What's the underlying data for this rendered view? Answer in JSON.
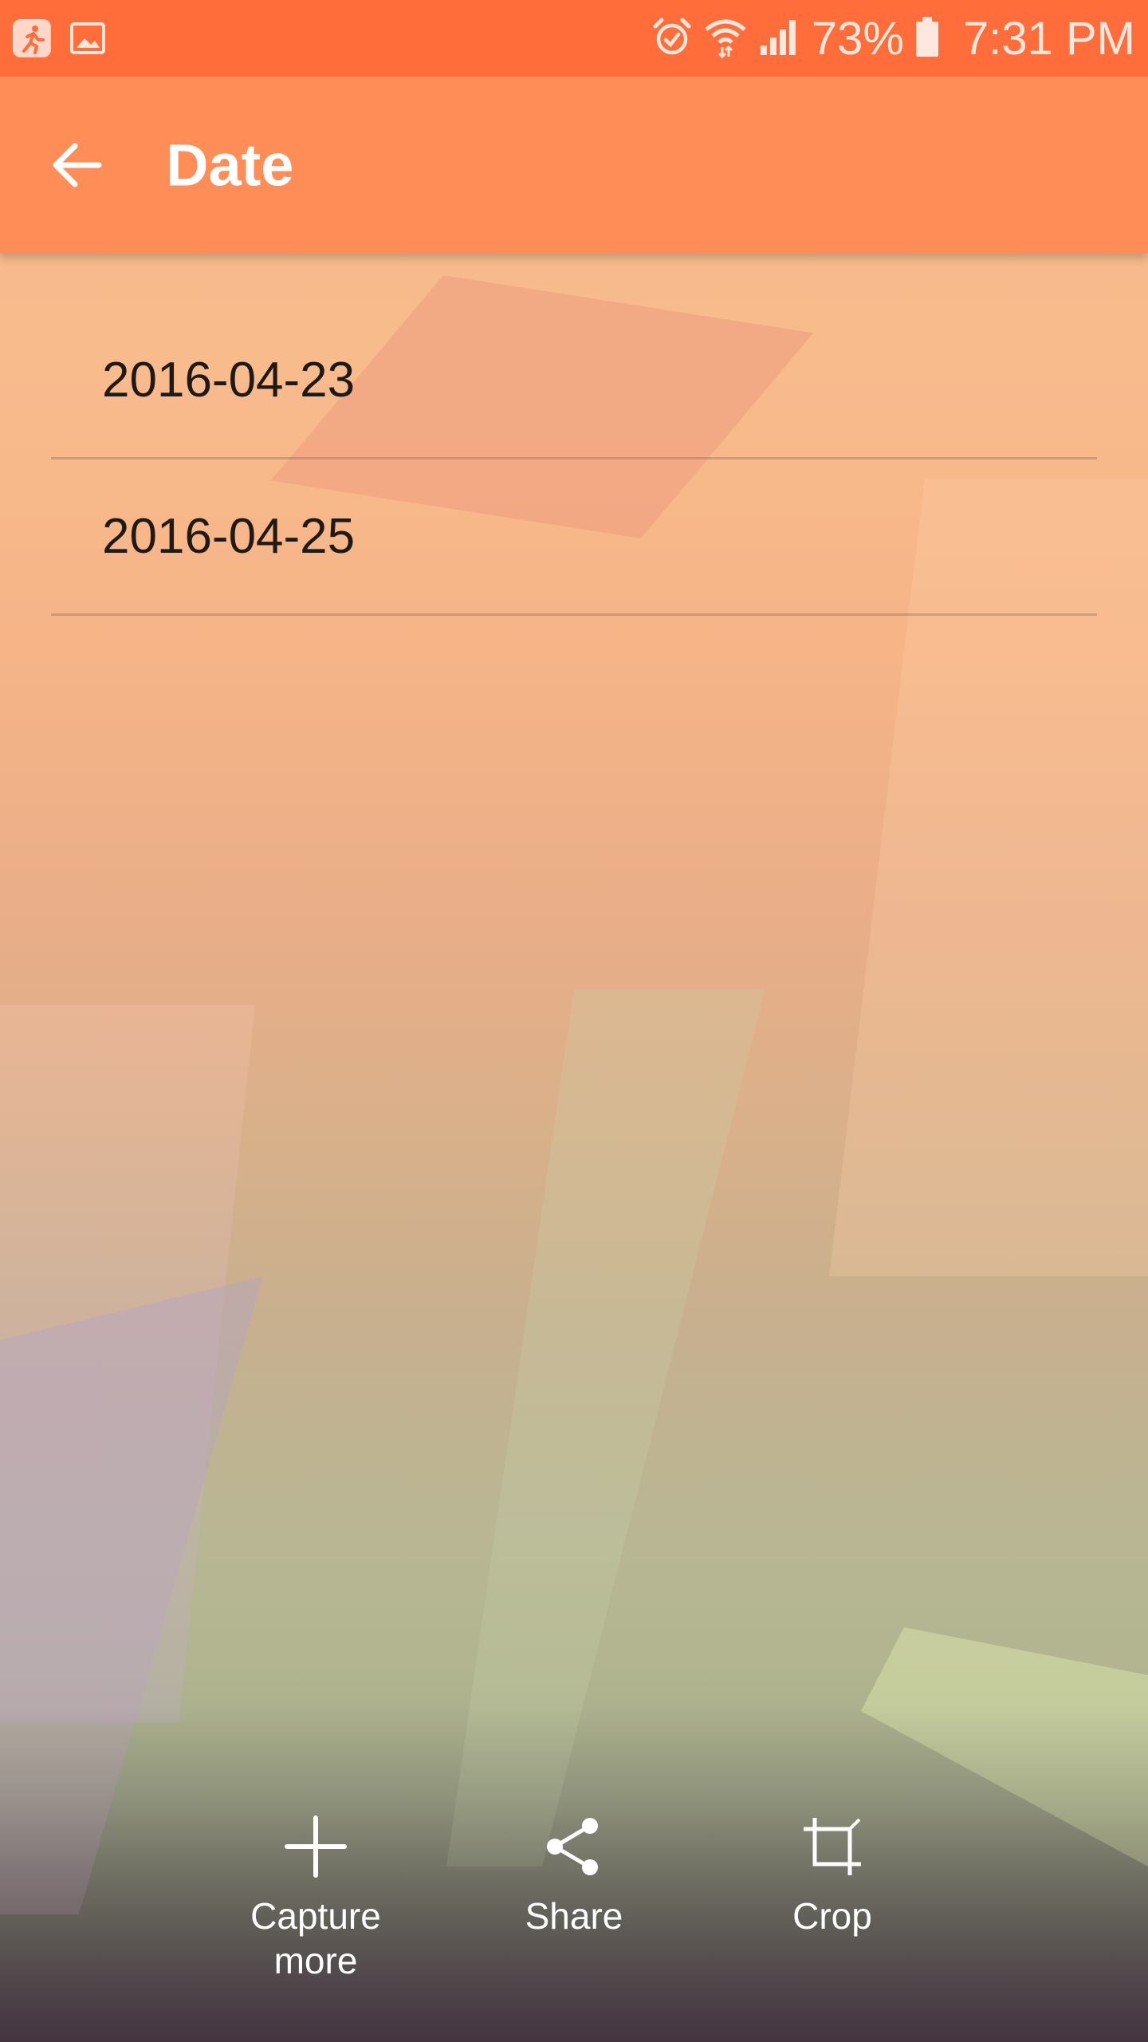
{
  "status_bar": {
    "battery": "73%",
    "time": "7:31 PM",
    "icons": [
      "running-app-icon",
      "gallery-icon",
      "alarm-icon",
      "wifi-icon",
      "signal-icon",
      "battery-icon"
    ]
  },
  "toolbar": {
    "back_icon": "arrow-left-icon",
    "title": "Date",
    "color": "#ff8d58"
  },
  "dates": [
    {
      "label": "2016-04-23"
    },
    {
      "label": "2016-04-25"
    }
  ],
  "actions": [
    {
      "icon": "plus-icon",
      "label": "Capture\nmore"
    },
    {
      "icon": "share-icon",
      "label": "Share"
    },
    {
      "icon": "crop-icon",
      "label": "Crop"
    }
  ],
  "colors": {
    "status_bar": "#ff6e3a",
    "accent": "#ff8d58"
  }
}
